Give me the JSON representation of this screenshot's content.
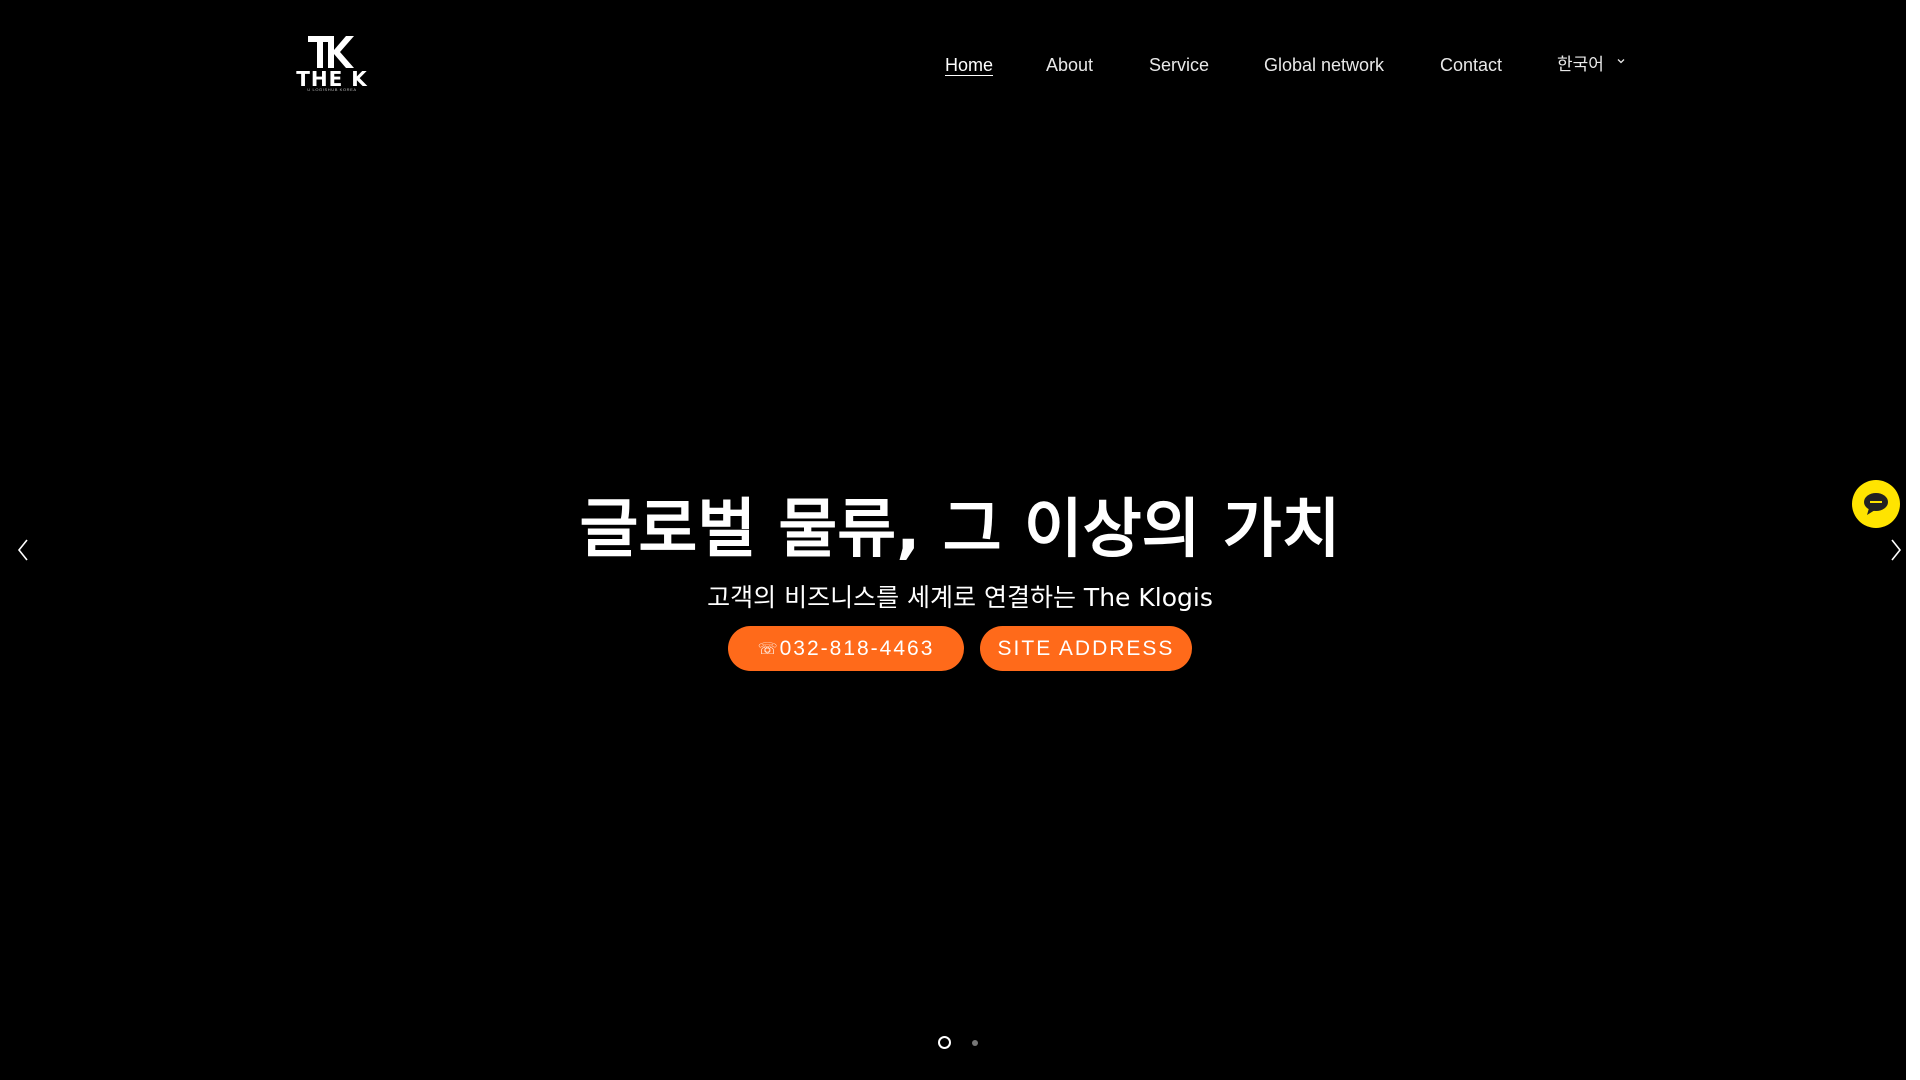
{
  "header": {
    "logo": {
      "mark": "TK",
      "name": "THE K",
      "tagline": "U LOGISHUB KOREA"
    },
    "nav": [
      {
        "label": "Home",
        "active": true
      },
      {
        "label": "About"
      },
      {
        "label": "Service"
      },
      {
        "label": "Global network"
      },
      {
        "label": "Contact"
      }
    ],
    "language": {
      "label": "한국어",
      "icon": "chevron-down-icon"
    }
  },
  "hero": {
    "title": "글로벌 물류, 그 이상의 가치",
    "subtitle": "고객의 비즈니스를 세계로 연결하는 The Klogis",
    "buttons": {
      "phone": {
        "icon": "☏",
        "label": "032-818-4463"
      },
      "site": {
        "label": "SITE ADDRESS"
      }
    },
    "slider": {
      "prev_icon": "chevron-left-icon",
      "next_icon": "chevron-right-icon",
      "slides": 2,
      "current": 1
    }
  },
  "chat": {
    "icon": "chat-bubble-icon",
    "color": "#ffe400"
  },
  "colors": {
    "background": "#000000",
    "accent": "#ff6a1a",
    "text": "#ffffff"
  }
}
